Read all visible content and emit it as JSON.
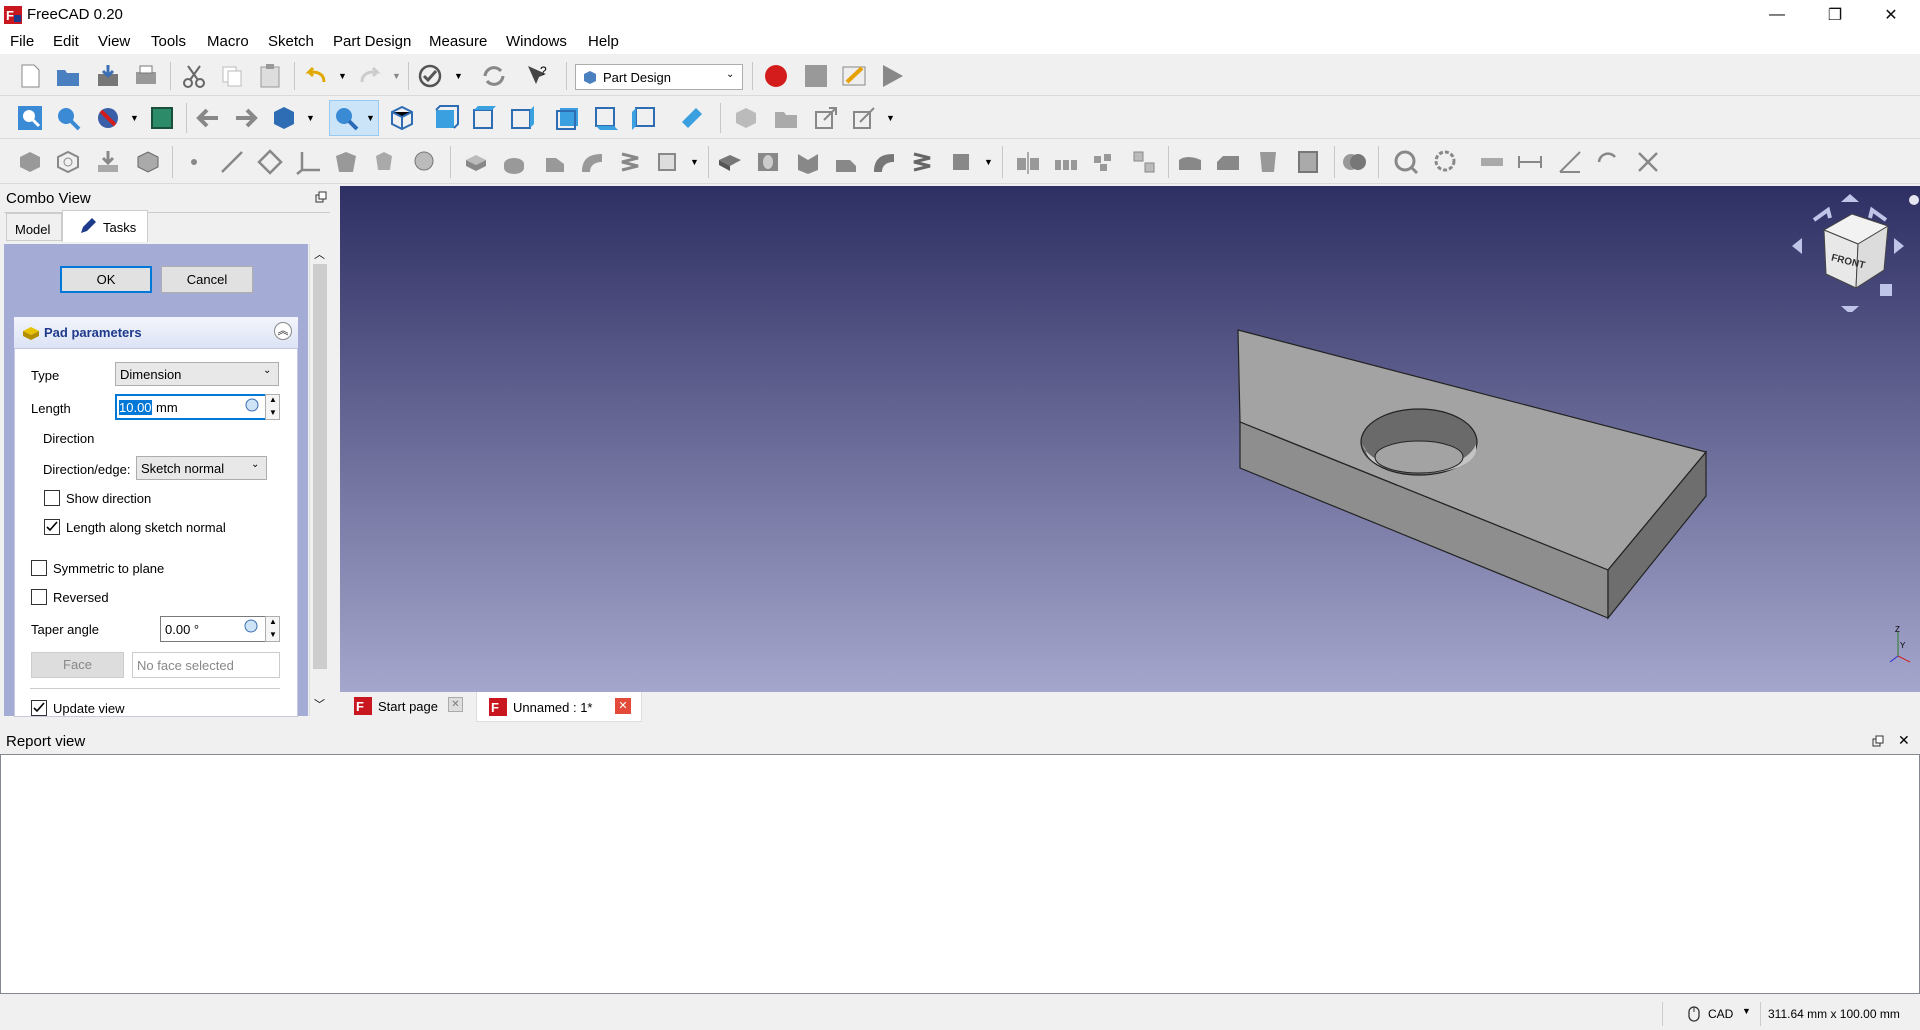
{
  "window": {
    "title": "FreeCAD 0.20",
    "minimize": "—",
    "maximize": "❐",
    "close": "✕"
  },
  "menu": [
    "File",
    "Edit",
    "View",
    "Tools",
    "Macro",
    "Sketch",
    "Part Design",
    "Measure",
    "Windows",
    "Help"
  ],
  "toolbar": {
    "workbench": "Part Design"
  },
  "combo": {
    "title": "Combo View",
    "tabs": [
      "Model",
      "Tasks"
    ]
  },
  "tasks": {
    "ok": "OK",
    "cancel": "Cancel",
    "section_title": "Pad parameters",
    "type_label": "Type",
    "type_value": "Dimension",
    "length_label": "Length",
    "length_value": "10.00",
    "length_unit": "mm",
    "direction_label": "Direction",
    "direction_edge_label": "Direction/edge:",
    "direction_edge_value": "Sketch normal",
    "show_direction": "Show direction",
    "show_direction_checked": false,
    "length_along": "Length along sketch normal",
    "length_along_checked": true,
    "symmetric": "Symmetric to plane",
    "symmetric_checked": false,
    "reversed": "Reversed",
    "reversed_checked": false,
    "taper_label": "Taper angle",
    "taper_value": "0.00 °",
    "face_button": "Face",
    "face_value": "No face selected",
    "update_view": "Update view",
    "update_view_checked": true
  },
  "doc_tabs": [
    {
      "label": "Start page"
    },
    {
      "label": "Unnamed : 1*"
    }
  ],
  "report": {
    "title": "Report view"
  },
  "status": {
    "nav": "CAD",
    "dimensions": "311.64 mm x 100.00 mm"
  },
  "colors": {
    "viewport_top": "#2e2f63",
    "viewport_bottom": "#a5a6cc",
    "task_panel": "#a4acd6",
    "accent": "#0078d7",
    "record": "#d41c1c"
  }
}
